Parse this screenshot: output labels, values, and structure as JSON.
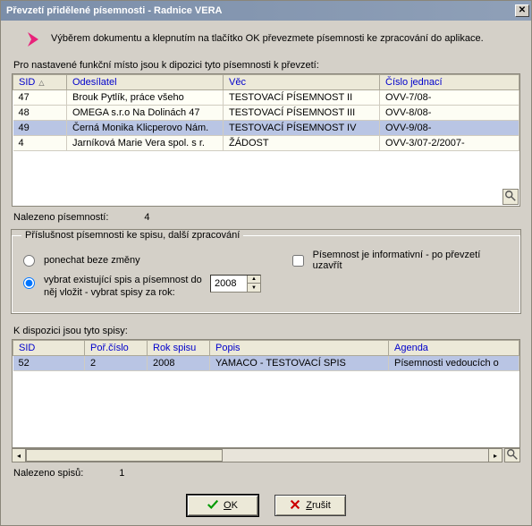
{
  "title": "Převzetí přidělené písemnosti - Radnice VERA",
  "intro": "Výběrem dokumentu a klepnutím na tlačítko OK převezmete písemnosti ke zpracování do aplikace.",
  "grid1_label": "Pro nastavené funkční místo jsou k dipozici tyto písemnosti k převzetí:",
  "grid1": {
    "headers": {
      "sid": "SID",
      "odesilatel": "Odesílatel",
      "vec": "Věc",
      "cislo": "Číslo jednací"
    },
    "rows": [
      {
        "sid": "47",
        "odesilatel": "Brouk Pytlík, práce všeho",
        "vec": "TESTOVACÍ PÍSEMNOST II",
        "cislo": "OVV-7/08-"
      },
      {
        "sid": "48",
        "odesilatel": "OMEGA s.r.o Na Dolinách 47",
        "vec": "TESTOVACÍ PÍSEMNOST III",
        "cislo": "OVV-8/08-"
      },
      {
        "sid": "49",
        "odesilatel": "Černá Monika  Klicperovo Nám.",
        "vec": "TESTOVACÍ PÍSEMNOST IV",
        "cislo": "OVV-9/08-"
      },
      {
        "sid": "4",
        "odesilatel": "Jarníková Marie Vera spol. s r.",
        "vec": "ŽÁDOST",
        "cislo": "OVV-3/07-2/2007-"
      }
    ],
    "selected_index": 2
  },
  "status1": {
    "label": "Nalezeno písemností:",
    "count": "4"
  },
  "groupbox": {
    "legend": "Příslušnost písemnosti ke spisu, další zpracování",
    "radio1": "ponechat beze změny",
    "radio2": "vybrat existující spis a písemnost do něj vložit - vybrat spisy za rok:",
    "radio_selected": 2,
    "year": "2008",
    "checkbox": "Písemnost je informativní - po převzetí uzavřít",
    "checkbox_checked": false
  },
  "grid2_label": "K dispozici jsou tyto spisy:",
  "grid2": {
    "headers": {
      "sid": "SID",
      "por": "Poř.číslo",
      "rok": "Rok spisu",
      "popis": "Popis",
      "agenda": "Agenda"
    },
    "rows": [
      {
        "sid": "52",
        "por": "2",
        "rok": "2008",
        "popis": "YAMACO - TESTOVACÍ SPIS",
        "agenda": "Písemnosti vedoucích o"
      }
    ],
    "selected_index": 0
  },
  "status2": {
    "label": "Nalezeno spisů:",
    "count": "1"
  },
  "buttons": {
    "ok": "OK",
    "cancel": "Zrušit"
  }
}
